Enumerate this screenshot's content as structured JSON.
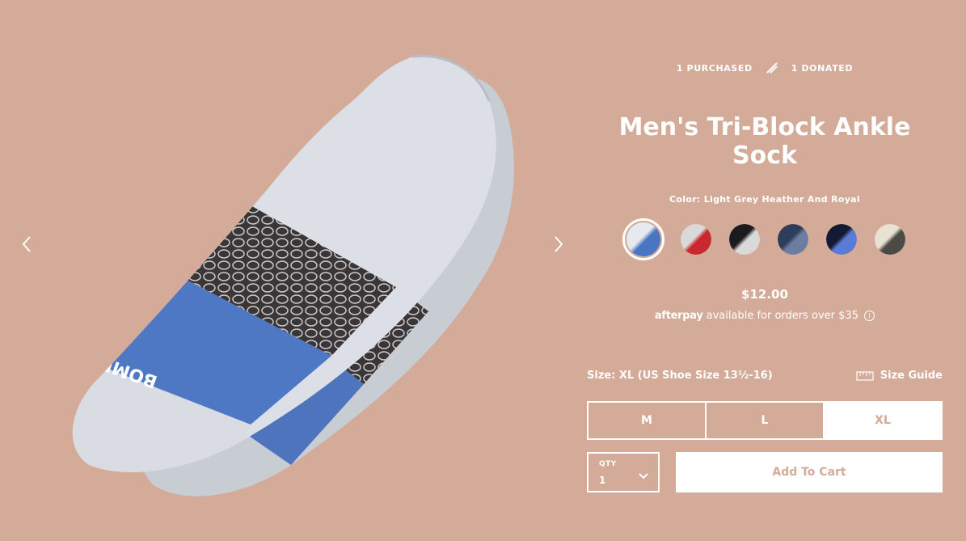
{
  "product": {
    "purchased": "1 PURCHASED",
    "donated": "1 DONATED",
    "title": "Men's Tri-Block Ankle Sock",
    "color_label": "Color: Light Grey Heather And Royal",
    "price": "$12.00",
    "afterpay_logo": "afterpay",
    "afterpay_text": "available for orders over $35",
    "size_label": "Size: XL (US Shoe Size 13½-16)",
    "size_guide": "Size Guide",
    "sizes": [
      "M",
      "L",
      "XL"
    ],
    "selected_size": "XL",
    "qty_label": "QTY",
    "qty_value": "1",
    "add_to_cart": "Add To Cart"
  },
  "swatches": [
    {
      "name": "light-grey-royal",
      "colors": [
        "#e6e9ef",
        "#4a74c4"
      ],
      "selected": true
    },
    {
      "name": "grey-red",
      "colors": [
        "#d9d9d9",
        "#c9282e"
      ],
      "selected": false
    },
    {
      "name": "black-white",
      "colors": [
        "#1b1b1e",
        "#d9d9d9"
      ],
      "selected": false
    },
    {
      "name": "navy-heather",
      "colors": [
        "#2d3d5a",
        "#6b7ea2"
      ],
      "selected": false
    },
    {
      "name": "navy-blue",
      "colors": [
        "#141a33",
        "#5a7bd6"
      ],
      "selected": false
    },
    {
      "name": "cream-charcoal",
      "colors": [
        "#e7e2d2",
        "#4b4a45"
      ],
      "selected": false
    }
  ],
  "colors": {
    "background": "#d4ab98",
    "text": "#ffffff"
  },
  "icons": {
    "prev": "chevron-left-icon",
    "next": "chevron-right-icon",
    "ruler": "ruler-icon",
    "qty_dropdown": "chevron-down-icon",
    "divider": "slash-icon"
  }
}
